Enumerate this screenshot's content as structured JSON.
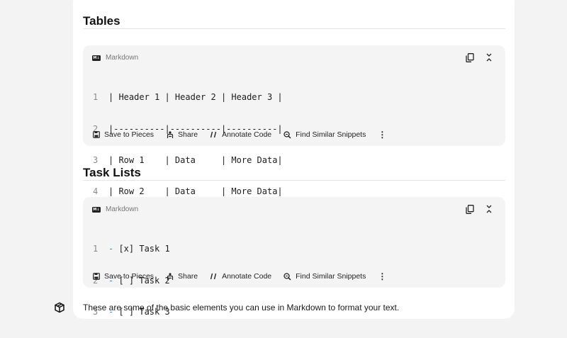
{
  "sections": [
    {
      "title": "Tables",
      "code_block": {
        "language": "Markdown",
        "lines": [
          {
            "num": "1",
            "text": "| Header 1 | Header 2 | Header 3 |"
          },
          {
            "num": "2",
            "text": "|----------|----------|----------|"
          },
          {
            "num": "3",
            "text": "| Row 1    | Data     | More Data|"
          },
          {
            "num": "4",
            "text": "| Row 2    | Data     | More Data|"
          }
        ]
      }
    },
    {
      "title": "Task Lists",
      "code_block": {
        "language": "Markdown",
        "lines": [
          {
            "num": "1",
            "dash": "-",
            "text": " [x] Task 1"
          },
          {
            "num": "2",
            "dash": "-",
            "text": " [ ] Task 2"
          },
          {
            "num": "3",
            "dash": "-",
            "text": " [ ] Task 3"
          }
        ]
      }
    }
  ],
  "toolbar": {
    "save_label": "Save to Pieces",
    "share_label": "Share",
    "annotate_label": "Annotate Code",
    "similar_label": "Find Similar Snippets",
    "more_label": "⋮"
  },
  "footer": {
    "text": "These are some of the basic elements you can use in Markdown to format your text."
  },
  "icons": {
    "copy": "copy-icon",
    "collapse": "collapse-icon",
    "markdown": "markdown-icon",
    "save": "save-icon",
    "share": "share-icon",
    "annotate": "annotate-icon",
    "similar": "search-icon",
    "assistant": "box-icon"
  }
}
